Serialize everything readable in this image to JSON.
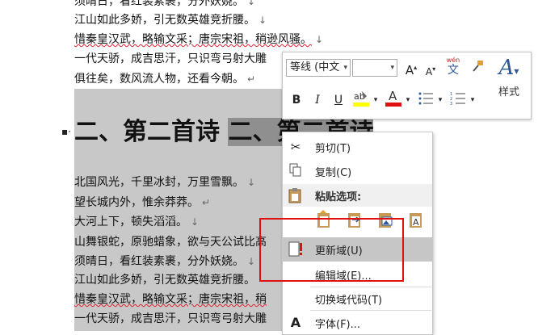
{
  "document": {
    "lines_top": [
      {
        "text": "须晴日，看红装素裹，分外妖娆。",
        "mark": "↓"
      },
      {
        "text": "江山如此多娇，引无数英雄竞折腰。",
        "mark": "↓"
      },
      {
        "text": "惜秦皇汉武，略输文采；唐宗宋祖，稍逊风骚。",
        "mark": "↓"
      },
      {
        "text": "一代天骄，成吉思汗，只识弯弓射大雕",
        "mark": ""
      },
      {
        "text": "俱往矣，数风流人物，还看今朝。",
        "mark": "↵"
      }
    ],
    "heading": {
      "text": "二、第二首诗",
      "field_text": "二、第二首诗"
    },
    "lines_bottom": [
      {
        "text": "北国风光，千里冰封，万里雪飘。",
        "mark": "↓"
      },
      {
        "text": "望长城内外，惟余莽莽。",
        "mark": "↵"
      },
      {
        "text": "大河上下，顿失滔滔。",
        "mark": "↓"
      },
      {
        "text": "山舞银蛇，原驰蜡象，欲与天公试比高",
        "mark": ""
      },
      {
        "text": "须晴日，看红装素裹，分外妖娆。",
        "mark": "↓"
      },
      {
        "text": "江山如此多娇，引无数英雄竞折腰。",
        "mark": ""
      },
      {
        "text": "惜秦皇汉武，略输文采；唐宗宋祖，稍",
        "mark": ""
      },
      {
        "text": "一代天骄，成吉思汗，只识弯弓射大雕",
        "mark": ""
      }
    ]
  },
  "mini_toolbar": {
    "font_name": "等线 (中文",
    "font_size": "",
    "style_label": "样式",
    "buttons": {
      "bold": "B",
      "italic": "I",
      "underline": "U",
      "grow": "A",
      "shrink": "A",
      "wen": "wén",
      "wen_char": "文"
    },
    "colors": {
      "highlight": "#ffff00",
      "font_color": "#e01010",
      "accent": "#2b5797"
    }
  },
  "context_menu": {
    "items": {
      "cut": "剪切(T)",
      "copy": "复制(C)",
      "paste_options": "粘贴选项:",
      "update_field": "更新域(U)",
      "edit_field": "编辑域(E)...",
      "toggle_codes": "切换域代码(T)",
      "font": "字体(F)..."
    }
  }
}
